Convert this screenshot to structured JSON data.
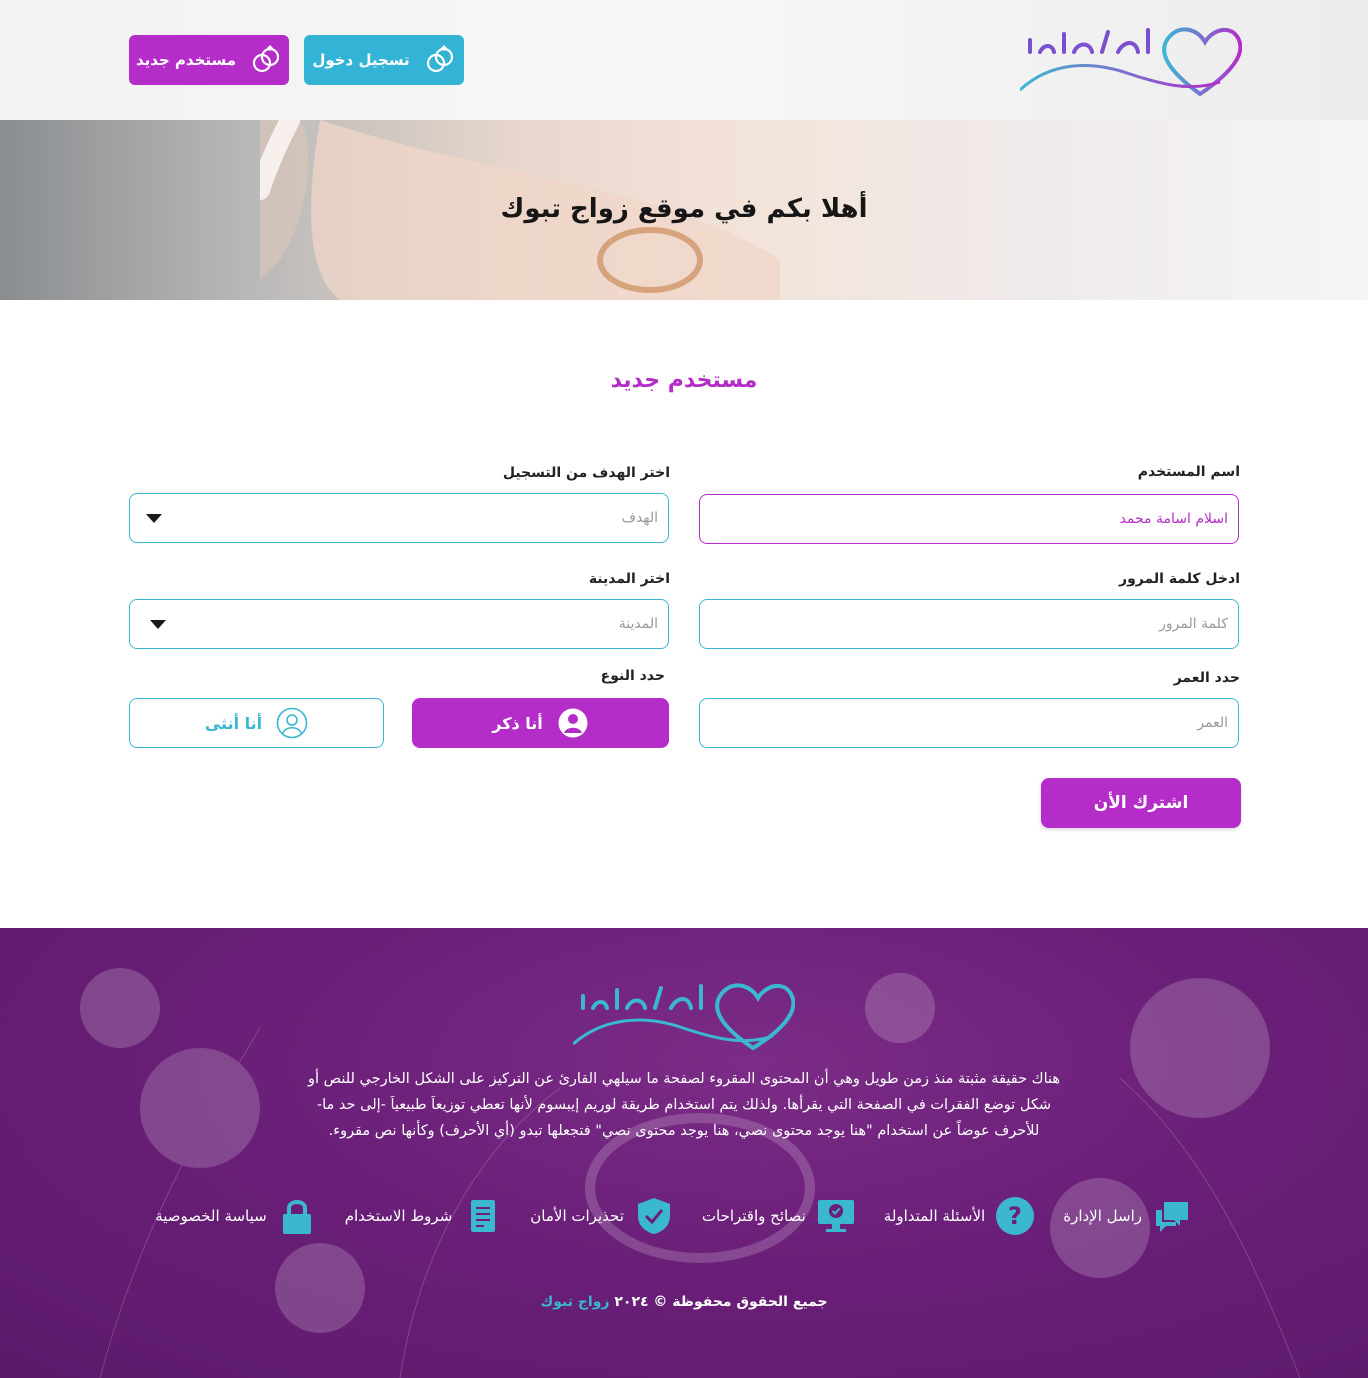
{
  "header": {
    "logo_alt": "زواج تبوك",
    "login_label": "تسجيل دخول",
    "new_user_label": "مستخدم جديد"
  },
  "hero": {
    "title": "أهلا بكم في موقع زواج تبوك"
  },
  "form": {
    "title": "مستخدم جديد",
    "username": {
      "label": "اسم المستخدم",
      "value": "اسلام اسامة محمد"
    },
    "goal": {
      "label": "اختر الهدف من التسجيل",
      "placeholder": "الهدف"
    },
    "password": {
      "label": "ادخل كلمة المرور",
      "placeholder": "كلمة المرور"
    },
    "city": {
      "label": "اختر المدينة",
      "placeholder": "المدينة"
    },
    "age": {
      "label": "حدد العمر",
      "placeholder": "العمر"
    },
    "gender": {
      "label": "حدد النوع",
      "male": "أنا ذكر",
      "female": "أنا أنثى",
      "selected": "male"
    },
    "submit_label": "اشترك الأن"
  },
  "footer": {
    "description_lines": [
      "هناك حقيقة مثبتة منذ زمن طويل وهي أن المحتوى المقروء لصفحة ما سيلهي القارئ عن التركيز على الشكل الخارجي للنص أو",
      "شكل توضع الفقرات في الصفحة التي يقرأها. ولذلك يتم استخدام طريقة لوريم إيبسوم لأنها تعطي توزيعاَ طبيعياَ -إلى حد ما-",
      "للأحرف عوضاً عن استخدام \"هنا يوجد محتوى نصي، هنا يوجد محتوى نصي\" فتجعلها تبدو (أي الأحرف) وكأنها نص مقروء."
    ],
    "links": [
      {
        "label": "راسل الإدارة",
        "icon": "chat-icon"
      },
      {
        "label": "الأسئلة المتداولة",
        "icon": "question-icon"
      },
      {
        "label": "نصائح واقتراحات",
        "icon": "monitor-icon"
      },
      {
        "label": "تحذيرات الأمان",
        "icon": "shield-icon"
      },
      {
        "label": "شروط الاستخدام",
        "icon": "document-icon"
      },
      {
        "label": "سياسة الخصوصية",
        "icon": "lock-icon"
      }
    ],
    "copyright_prefix": "جميع الحقوق محفوظة © ٢٠٢٤",
    "copyright_brand": "زواج تبوك"
  },
  "colors": {
    "primary_purple": "#b42dc9",
    "accent_cyan": "#33b3d6",
    "footer_bg": "#6a1f78"
  }
}
